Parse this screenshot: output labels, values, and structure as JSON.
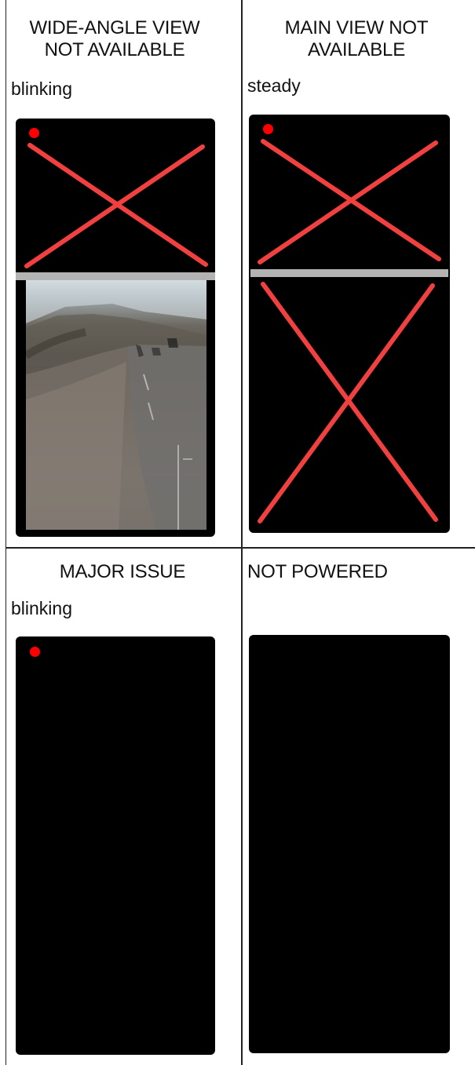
{
  "cells": [
    {
      "title": "WIDE-ANGLE VIEW\nNOT AVAILABLE",
      "state": "blinking",
      "screen": {
        "indicator": "red-dot",
        "top_view": "crossed-out",
        "bottom_view": "live-road-image"
      }
    },
    {
      "title": "MAIN VIEW NOT\nAVAILABLE",
      "state": "steady",
      "screen": {
        "indicator": "red-dot",
        "top_view": "crossed-out",
        "bottom_view": "crossed-out"
      }
    },
    {
      "title": "MAJOR ISSUE",
      "state": "blinking",
      "screen": {
        "indicator": "red-dot",
        "top_view": "black",
        "bottom_view": "black"
      }
    },
    {
      "title": "NOT POWERED",
      "state": "",
      "screen": {
        "indicator": "none",
        "top_view": "black",
        "bottom_view": "black"
      }
    }
  ],
  "colors": {
    "indicator": "#ff0000",
    "cross": "#f04040",
    "divider": "#b3b3b3",
    "screen": "#000000"
  }
}
